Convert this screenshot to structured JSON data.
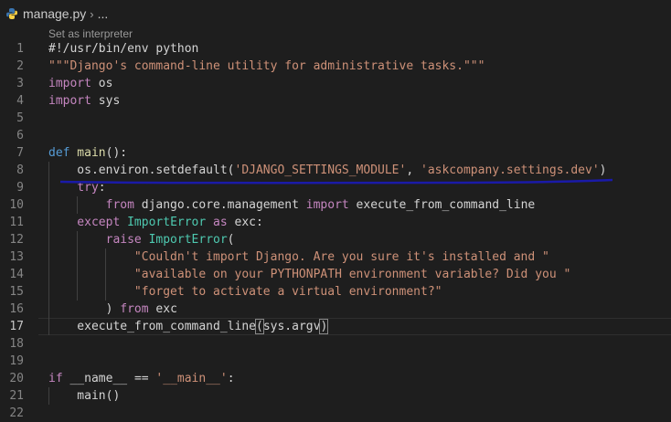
{
  "breadcrumb": {
    "filename": "manage.py",
    "chevron": "›",
    "more": "..."
  },
  "codelens": "Set as interpreter",
  "lines": [
    {
      "n": "1",
      "tokens": [
        {
          "t": "#!/usr/bin/env python",
          "c": "tok-plain"
        }
      ]
    },
    {
      "n": "2",
      "tokens": [
        {
          "t": "\"\"\"Django's command-line utility for administrative tasks.\"\"\"",
          "c": "tok-str"
        }
      ]
    },
    {
      "n": "3",
      "tokens": [
        {
          "t": "import",
          "c": "tok-kw2"
        },
        {
          "t": " os",
          "c": "tok-plain"
        }
      ]
    },
    {
      "n": "4",
      "tokens": [
        {
          "t": "import",
          "c": "tok-kw2"
        },
        {
          "t": " sys",
          "c": "tok-plain"
        }
      ]
    },
    {
      "n": "5",
      "tokens": []
    },
    {
      "n": "6",
      "tokens": []
    },
    {
      "n": "7",
      "tokens": [
        {
          "t": "def",
          "c": "tok-kw"
        },
        {
          "t": " main",
          "c": "tok-fn"
        },
        {
          "t": "():",
          "c": "tok-plain"
        }
      ]
    },
    {
      "n": "8",
      "tokens": [
        {
          "t": "    os.environ.setdefault(",
          "c": "tok-plain"
        },
        {
          "t": "'DJANGO_SETTINGS_MODULE'",
          "c": "tok-str"
        },
        {
          "t": ", ",
          "c": "tok-plain"
        },
        {
          "t": "'askcompany.settings.dev'",
          "c": "tok-str"
        },
        {
          "t": ")",
          "c": "tok-plain"
        }
      ]
    },
    {
      "n": "9",
      "tokens": [
        {
          "t": "    try",
          "c": "tok-kw2"
        },
        {
          "t": ":",
          "c": "tok-plain"
        }
      ]
    },
    {
      "n": "10",
      "tokens": [
        {
          "t": "        from",
          "c": "tok-kw2"
        },
        {
          "t": " django.core.management ",
          "c": "tok-plain"
        },
        {
          "t": "import",
          "c": "tok-kw2"
        },
        {
          "t": " execute_from_command_line",
          "c": "tok-plain"
        }
      ]
    },
    {
      "n": "11",
      "tokens": [
        {
          "t": "    except",
          "c": "tok-kw2"
        },
        {
          "t": " ",
          "c": "tok-plain"
        },
        {
          "t": "ImportError",
          "c": "tok-cls"
        },
        {
          "t": " as",
          "c": "tok-kw2"
        },
        {
          "t": " exc:",
          "c": "tok-plain"
        }
      ]
    },
    {
      "n": "12",
      "tokens": [
        {
          "t": "        raise",
          "c": "tok-kw2"
        },
        {
          "t": " ",
          "c": "tok-plain"
        },
        {
          "t": "ImportError",
          "c": "tok-cls"
        },
        {
          "t": "(",
          "c": "tok-plain"
        }
      ]
    },
    {
      "n": "13",
      "tokens": [
        {
          "t": "            \"Couldn't import Django. Are you sure it's installed and \"",
          "c": "tok-str"
        }
      ]
    },
    {
      "n": "14",
      "tokens": [
        {
          "t": "            \"available on your PYTHONPATH environment variable? Did you \"",
          "c": "tok-str"
        }
      ]
    },
    {
      "n": "15",
      "tokens": [
        {
          "t": "            \"forget to activate a virtual environment?\"",
          "c": "tok-str"
        }
      ]
    },
    {
      "n": "16",
      "tokens": [
        {
          "t": "        ) ",
          "c": "tok-plain"
        },
        {
          "t": "from",
          "c": "tok-kw2"
        },
        {
          "t": " exc",
          "c": "tok-plain"
        }
      ]
    },
    {
      "n": "17",
      "tokens": [
        {
          "t": "    execute_from_command_line",
          "c": "tok-plain"
        },
        {
          "t": "(",
          "c": "tok-plain bracket"
        },
        {
          "t": "sys.argv",
          "c": "tok-plain"
        },
        {
          "t": ")",
          "c": "tok-plain bracket"
        }
      ],
      "current": true
    },
    {
      "n": "18",
      "tokens": []
    },
    {
      "n": "19",
      "tokens": []
    },
    {
      "n": "20",
      "tokens": [
        {
          "t": "if",
          "c": "tok-kw2"
        },
        {
          "t": " __name__ ",
          "c": "tok-plain"
        },
        {
          "t": "==",
          "c": "tok-plain"
        },
        {
          "t": " ",
          "c": "tok-plain"
        },
        {
          "t": "'__main__'",
          "c": "tok-str"
        },
        {
          "t": ":",
          "c": "tok-plain"
        }
      ]
    },
    {
      "n": "21",
      "tokens": [
        {
          "t": "    main()",
          "c": "tok-plain"
        }
      ]
    },
    {
      "n": "22",
      "tokens": []
    }
  ],
  "colors": {
    "background": "#1e1e1e",
    "underline": "#1a1aa8"
  }
}
